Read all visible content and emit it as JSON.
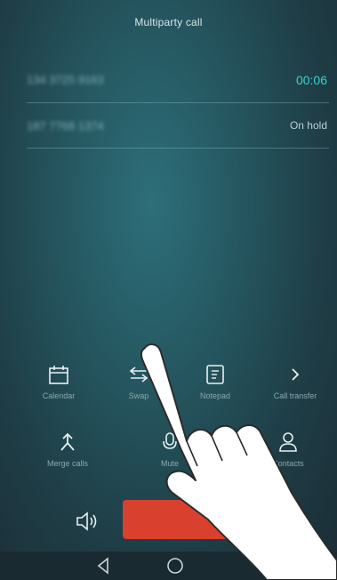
{
  "screen": {
    "title": "Multiparty call"
  },
  "calls": [
    {
      "number": "134 3725 9163",
      "status": "00:06"
    },
    {
      "number": "187 7768 1374",
      "status": "On hold"
    }
  ],
  "actions": {
    "calendar": "Calendar",
    "swap": "Swap",
    "notepad": "Notepad",
    "call_transfer": "Call transfer",
    "merge_calls": "Merge calls",
    "mute": "Mute",
    "contacts": "Contacts"
  },
  "colors": {
    "active_timer": "#39d3d0",
    "end_call": "#d9402e"
  }
}
